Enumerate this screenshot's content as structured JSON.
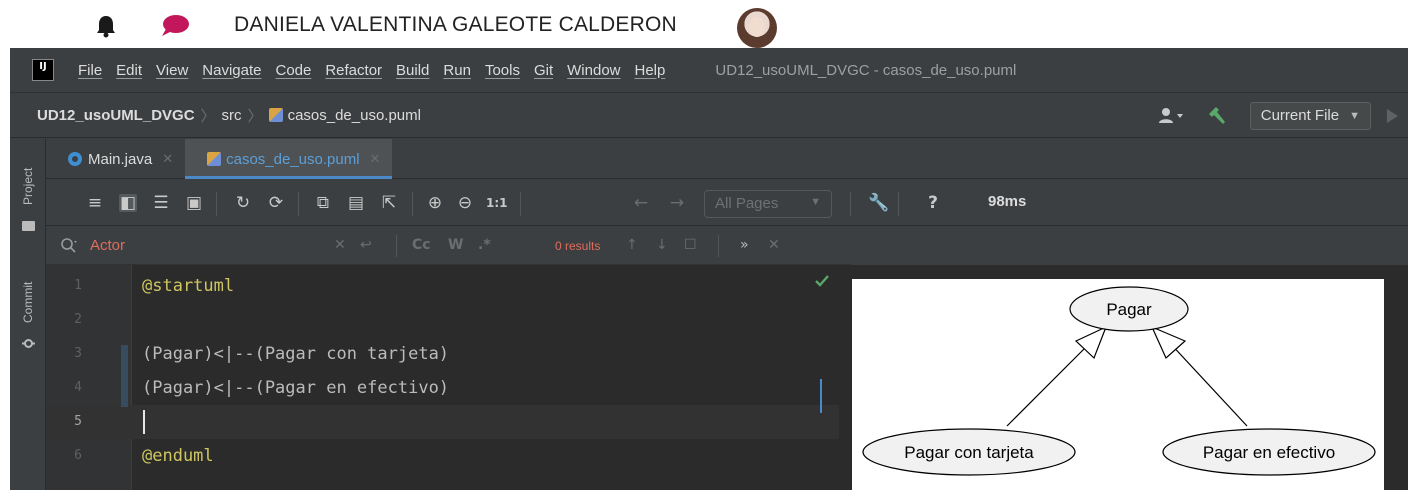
{
  "user_bar": {
    "username": "DANIELA VALENTINA GALEOTE CALDERON",
    "notification_icon": "bell-icon",
    "chat_icon": "chat-bubble-icon",
    "accent": "#c2185b"
  },
  "menubar": {
    "logo_text": "IJ",
    "items": [
      "File",
      "Edit",
      "View",
      "Navigate",
      "Code",
      "Refactor",
      "Build",
      "Run",
      "Tools",
      "Git",
      "Window",
      "Help"
    ],
    "window_title": "UD12_usoUML_DVGC - casos_de_uso.puml"
  },
  "navbar": {
    "project": "UD12_usoUML_DVGC",
    "folder": "src",
    "file": "casos_de_uso.puml",
    "run_config": "Current File"
  },
  "tool_windows": {
    "project_label": "Project",
    "commit_label": "Commit"
  },
  "tabs": [
    {
      "label": "Main.java",
      "active": false
    },
    {
      "label": "casos_de_uso.puml",
      "active": true
    }
  ],
  "puml_toolbar": {
    "zoom_actual": "1:1",
    "pages": "All Pages",
    "help": "?",
    "render_time": "98ms"
  },
  "search": {
    "query": "Actor",
    "results": "0 results",
    "match_case": "Cc",
    "words": "W",
    "regex": ".*",
    "more": "»"
  },
  "editor": {
    "lines": [
      {
        "n": "1",
        "text": "@startuml"
      },
      {
        "n": "2",
        "text": ""
      },
      {
        "n": "3",
        "text": "(Pagar)<|--(Pagar con tarjeta)"
      },
      {
        "n": "4",
        "text": "(Pagar)<|--(Pagar en efectivo)"
      },
      {
        "n": "5",
        "text": ""
      },
      {
        "n": "6",
        "text": "@enduml"
      }
    ],
    "current_line": "5"
  },
  "diagram": {
    "parent": "Pagar",
    "children": [
      "Pagar con tarjeta",
      "Pagar en efectivo"
    ]
  }
}
